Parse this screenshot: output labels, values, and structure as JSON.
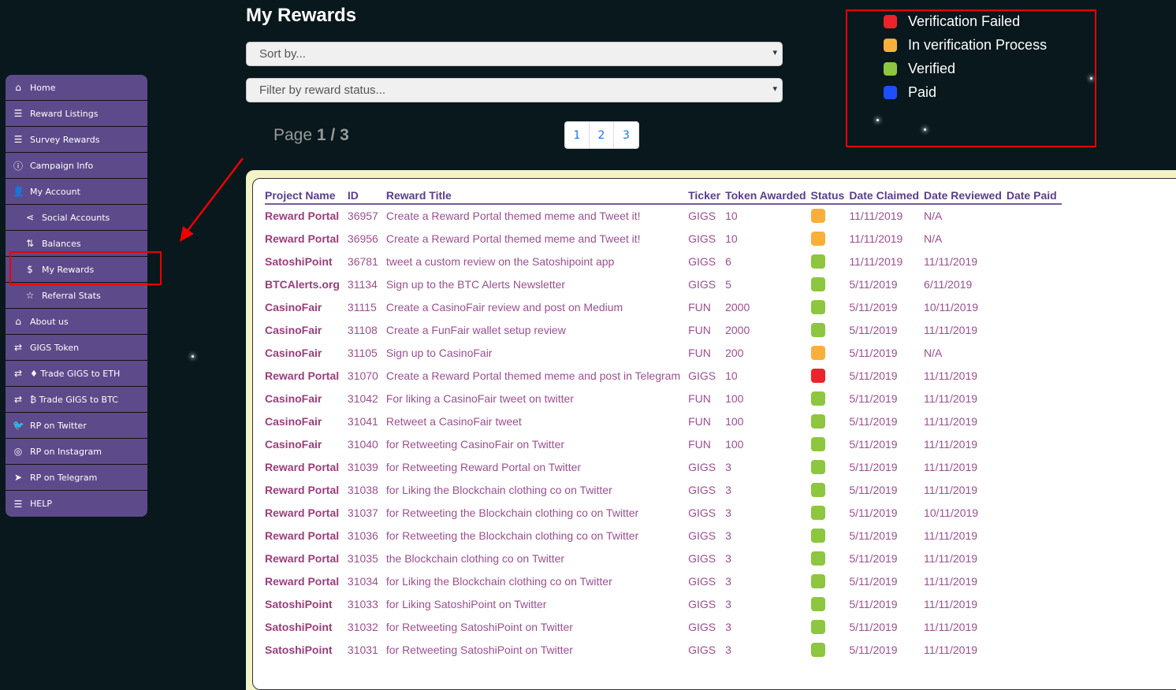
{
  "colors": {
    "failed": "#ee2229",
    "process": "#f9b03a",
    "verified": "#8dc63f",
    "paid": "#1d4fff"
  },
  "sidebar": [
    {
      "label": "Home",
      "icon": "home-icon",
      "glyph": "⌂",
      "sub": false
    },
    {
      "label": "Reward Listings",
      "icon": "list-icon",
      "glyph": "☰",
      "sub": false
    },
    {
      "label": "Survey Rewards",
      "icon": "list-icon",
      "glyph": "☰",
      "sub": false
    },
    {
      "label": "Campaign Info",
      "icon": "info-icon",
      "glyph": "ⓘ",
      "sub": false
    },
    {
      "label": "My Account",
      "icon": "user-icon",
      "glyph": "👤",
      "sub": false
    },
    {
      "label": "Social Accounts",
      "icon": "share-icon",
      "glyph": "⋖",
      "sub": true
    },
    {
      "label": "Balances",
      "icon": "sort-amount-icon",
      "glyph": "⇅",
      "sub": true
    },
    {
      "label": "My Rewards",
      "icon": "hand-dollar-icon",
      "glyph": "$",
      "sub": true
    },
    {
      "label": "Referral Stats",
      "icon": "star-icon",
      "glyph": "☆",
      "sub": true
    },
    {
      "label": "About us",
      "icon": "home-icon",
      "glyph": "⌂",
      "sub": false
    },
    {
      "label": "GIGS Token",
      "icon": "exchange-icon",
      "glyph": "⇄",
      "sub": false
    },
    {
      "label": "♦ Trade GIGS to ETH",
      "icon": "exchange-icon",
      "glyph": "⇄",
      "sub": false
    },
    {
      "label": "₿ Trade GIGS to BTC",
      "icon": "exchange-icon",
      "glyph": "⇄",
      "sub": false
    },
    {
      "label": "RP on Twitter",
      "icon": "twitter-icon",
      "glyph": "🐦",
      "sub": false
    },
    {
      "label": "RP on Instagram",
      "icon": "instagram-icon",
      "glyph": "◎",
      "sub": false
    },
    {
      "label": "RP on Telegram",
      "icon": "telegram-icon",
      "glyph": "➤",
      "sub": false
    },
    {
      "label": "HELP",
      "icon": "list-icon",
      "glyph": "☰",
      "sub": false
    }
  ],
  "title": "My Rewards",
  "sort_placeholder": "Sort by...",
  "filter_placeholder": "Filter by reward status...",
  "page": {
    "label": "Page",
    "current": "1 / 3",
    "pages": [
      "1",
      "2",
      "3"
    ]
  },
  "legend": [
    {
      "label": "Verification Failed",
      "status": "failed"
    },
    {
      "label": "In verification Process",
      "status": "process"
    },
    {
      "label": "Verified",
      "status": "verified"
    },
    {
      "label": "Paid",
      "status": "paid"
    }
  ],
  "table": {
    "headers": [
      "Project Name",
      "ID",
      "Reward Title",
      "Ticker",
      "Token Awarded",
      "Status",
      "Date Claimed",
      "Date Reviewed",
      "Date Paid"
    ],
    "rows": [
      [
        "Reward Portal",
        "36957",
        "Create a Reward Portal themed meme and Tweet it!",
        "GIGS",
        "10",
        "process",
        "11/11/2019",
        "N/A",
        ""
      ],
      [
        "Reward Portal",
        "36956",
        "Create a Reward Portal themed meme and Tweet it!",
        "GIGS",
        "10",
        "process",
        "11/11/2019",
        "N/A",
        ""
      ],
      [
        "SatoshiPoint",
        "36781",
        "tweet a custom review on the Satoshipoint app",
        "GIGS",
        "6",
        "verified",
        "11/11/2019",
        "11/11/2019",
        ""
      ],
      [
        "BTCAlerts.org",
        "31134",
        "Sign up to the BTC Alerts Newsletter",
        "GIGS",
        "5",
        "verified",
        "5/11/2019",
        "6/11/2019",
        ""
      ],
      [
        "CasinoFair",
        "31115",
        "Create a CasinoFair review and post on Medium",
        "FUN",
        "2000",
        "verified",
        "5/11/2019",
        "10/11/2019",
        ""
      ],
      [
        "CasinoFair",
        "31108",
        "Create a FunFair wallet setup review",
        "FUN",
        "2000",
        "verified",
        "5/11/2019",
        "11/11/2019",
        ""
      ],
      [
        "CasinoFair",
        "31105",
        "Sign up to CasinoFair",
        "FUN",
        "200",
        "process",
        "5/11/2019",
        "N/A",
        ""
      ],
      [
        "Reward Portal",
        "31070",
        "Create a Reward Portal themed meme and post in Telegram",
        "GIGS",
        "10",
        "failed",
        "5/11/2019",
        "11/11/2019",
        ""
      ],
      [
        "CasinoFair",
        "31042",
        "For liking a CasinoFair tweet on twitter",
        "FUN",
        "100",
        "verified",
        "5/11/2019",
        "11/11/2019",
        ""
      ],
      [
        "CasinoFair",
        "31041",
        "Retweet a CasinoFair tweet",
        "FUN",
        "100",
        "verified",
        "5/11/2019",
        "11/11/2019",
        ""
      ],
      [
        "CasinoFair",
        "31040",
        "for Retweeting CasinoFair on Twitter",
        "FUN",
        "100",
        "verified",
        "5/11/2019",
        "11/11/2019",
        ""
      ],
      [
        "Reward Portal",
        "31039",
        "for Retweeting Reward Portal on Twitter",
        "GIGS",
        "3",
        "verified",
        "5/11/2019",
        "11/11/2019",
        ""
      ],
      [
        "Reward Portal",
        "31038",
        "for Liking the Blockchain clothing co on Twitter",
        "GIGS",
        "3",
        "verified",
        "5/11/2019",
        "11/11/2019",
        ""
      ],
      [
        "Reward Portal",
        "31037",
        "for Retweeting the Blockchain clothing co on Twitter",
        "GIGS",
        "3",
        "verified",
        "5/11/2019",
        "10/11/2019",
        ""
      ],
      [
        "Reward Portal",
        "31036",
        "for Retweeting the Blockchain clothing co on Twitter",
        "GIGS",
        "3",
        "verified",
        "5/11/2019",
        "11/11/2019",
        ""
      ],
      [
        "Reward Portal",
        "31035",
        "the Blockchain clothing co on Twitter",
        "GIGS",
        "3",
        "verified",
        "5/11/2019",
        "11/11/2019",
        ""
      ],
      [
        "Reward Portal",
        "31034",
        "for Liking the Blockchain clothing co on Twitter",
        "GIGS",
        "3",
        "verified",
        "5/11/2019",
        "11/11/2019",
        ""
      ],
      [
        "SatoshiPoint",
        "31033",
        "for Liking SatoshiPoint on Twitter",
        "GIGS",
        "3",
        "verified",
        "5/11/2019",
        "11/11/2019",
        ""
      ],
      [
        "SatoshiPoint",
        "31032",
        "for Retweeting SatoshiPoint on Twitter",
        "GIGS",
        "3",
        "verified",
        "5/11/2019",
        "11/11/2019",
        ""
      ],
      [
        "SatoshiPoint",
        "31031",
        "for Retweeting SatoshiPoint on Twitter",
        "GIGS",
        "3",
        "verified",
        "5/11/2019",
        "11/11/2019",
        ""
      ]
    ]
  }
}
